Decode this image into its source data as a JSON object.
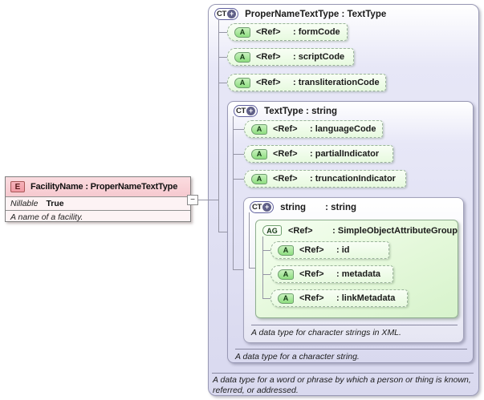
{
  "element": {
    "badge": "E",
    "title": "FacilityName : ProperNameTextType",
    "nillable_label": "Nillable",
    "nillable_value": "True",
    "annotation": "A name of a facility."
  },
  "toggle": {
    "glyph": "−"
  },
  "outer": {
    "badge": "CT",
    "plus": "+",
    "title": "ProperNameTextType : TextType",
    "attributes": [
      {
        "badge": "A",
        "ref": "<Ref>",
        "name": ": formCode"
      },
      {
        "badge": "A",
        "ref": "<Ref>",
        "name": ": scriptCode"
      },
      {
        "badge": "A",
        "ref": "<Ref>",
        "name": ": transliterationCode"
      }
    ],
    "annotation": "A data type for a word or phrase by which a person or thing is known, referred, or addressed.",
    "texttype": {
      "badge": "CT",
      "plus": "+",
      "title": "TextType : string",
      "attributes": [
        {
          "badge": "A",
          "ref": "<Ref>",
          "name": ": languageCode"
        },
        {
          "badge": "A",
          "ref": "<Ref>",
          "name": ": partialIndicator"
        },
        {
          "badge": "A",
          "ref": "<Ref>",
          "name": ": truncationIndicator"
        }
      ],
      "annotation": "A data type for a character string.",
      "string": {
        "badge": "CT",
        "plus": "+",
        "title_name": "string",
        "title_type": ": string",
        "annotation": "A data type for character strings in XML.",
        "group": {
          "badge": "AG",
          "ref": "<Ref>",
          "name": ": SimpleObjectAttributeGroup",
          "attributes": [
            {
              "badge": "A",
              "ref": "<Ref>",
              "name": ": id"
            },
            {
              "badge": "A",
              "ref": "<Ref>",
              "name": ": metadata"
            },
            {
              "badge": "A",
              "ref": "<Ref>",
              "name": ": linkMetadata"
            }
          ]
        }
      }
    }
  }
}
